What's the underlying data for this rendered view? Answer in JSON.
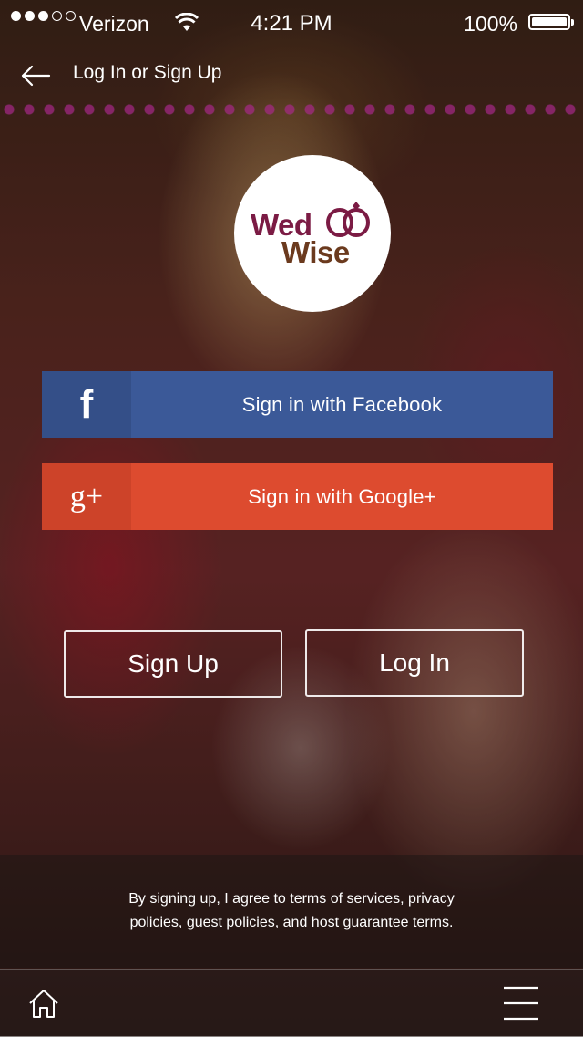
{
  "status_bar": {
    "carrier": "Verizon",
    "time": "4:21 PM",
    "battery": "100%",
    "signal_bars_filled": 3,
    "signal_bars_total": 5
  },
  "header": {
    "title": "Log In or Sign Up"
  },
  "logo": {
    "line1": "Wed",
    "line2": "Wise",
    "colors": {
      "wed": "#7b1b44",
      "wise": "#6b3a1e"
    }
  },
  "social": {
    "facebook": {
      "icon": "f",
      "label": "Sign in with Facebook",
      "color": "#3b5998"
    },
    "google": {
      "icon": "g+",
      "label": "Sign in with Google+",
      "color": "#dd4b2f"
    }
  },
  "actions": {
    "signup_label": "Sign Up",
    "login_label": "Log In"
  },
  "terms": {
    "text": "By signing up, I agree to  terms of services, privacy policies, guest policies, and host guarantee terms."
  },
  "bottom_nav": {
    "icons": [
      "home-icon",
      "menu-icon"
    ]
  }
}
